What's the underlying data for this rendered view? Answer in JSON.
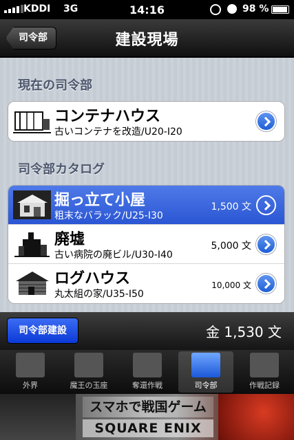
{
  "status_bar": {
    "carrier": "KDDI",
    "network": "3G",
    "time": "14:16",
    "battery": "98 %"
  },
  "nav": {
    "back_label": "司令部",
    "title": "建設現場"
  },
  "current_section": {
    "header": "現在の司令部",
    "item": {
      "name": "コンテナハウス",
      "desc": "古いコンテナを改造/U20-I20"
    }
  },
  "catalog": {
    "header": "司令部カタログ",
    "items": [
      {
        "name": "掘っ立て小屋",
        "desc": "粗末なバラック/U25-I30",
        "price": "1,500 文",
        "selected": true
      },
      {
        "name": "廃墟",
        "desc": "古い病院の廃ビル/U30-I40",
        "price": "5,000 文",
        "selected": false
      },
      {
        "name": "ログハウス",
        "desc": "丸太組の家/U35-I50",
        "price": "10,000 文",
        "selected": false
      }
    ]
  },
  "build_bar": {
    "build_label": "司令部建設",
    "gold": "金 1,530 文"
  },
  "tabs": [
    {
      "label": "外界",
      "icon": "gate-icon",
      "active": false
    },
    {
      "label": "魔王の玉座",
      "icon": "demon-king-icon",
      "active": false
    },
    {
      "label": "奪還作戦",
      "icon": "map-icon",
      "active": false
    },
    {
      "label": "司令部",
      "icon": "headquarters-icon",
      "active": true
    },
    {
      "label": "作戦記録",
      "icon": "record-icon",
      "active": false
    }
  ],
  "ad": {
    "line1": "スマホで戦国ゲーム",
    "line2": "SQUARE ENIX"
  },
  "colors": {
    "accent_blue": "#2a56d4",
    "section_header": "#4c566c"
  }
}
